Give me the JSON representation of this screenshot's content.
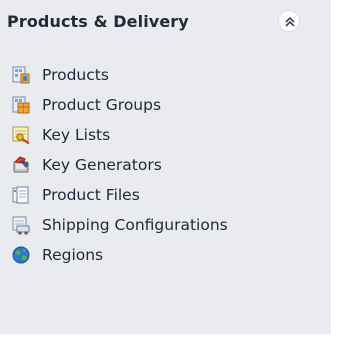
{
  "panel": {
    "title": "Products & Delivery",
    "collapse_icon": "double-chevron-up-icon"
  },
  "items": [
    {
      "label": "Products",
      "icon": "products-icon"
    },
    {
      "label": "Product Groups",
      "icon": "product-groups-icon"
    },
    {
      "label": "Key Lists",
      "icon": "key-lists-icon"
    },
    {
      "label": "Key Generators",
      "icon": "key-generators-icon"
    },
    {
      "label": "Product Files",
      "icon": "product-files-icon"
    },
    {
      "label": "Shipping Configurations",
      "icon": "shipping-configurations-icon"
    },
    {
      "label": "Regions",
      "icon": "regions-icon"
    }
  ]
}
